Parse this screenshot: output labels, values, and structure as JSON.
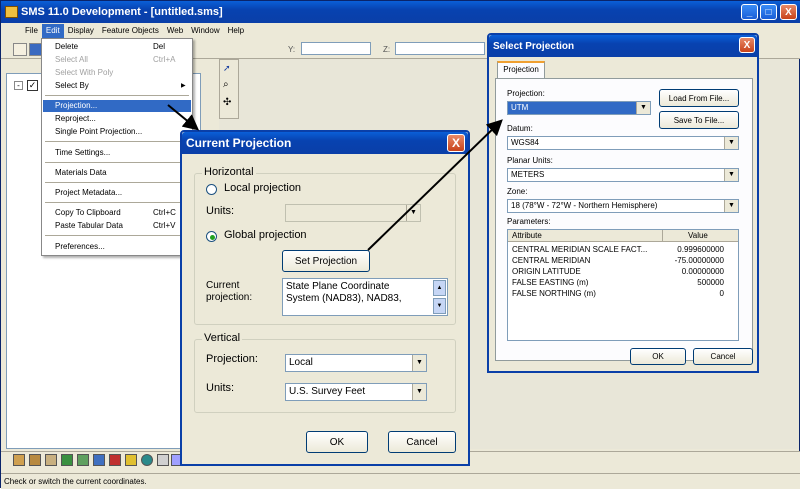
{
  "app": {
    "title": "SMS 11.0 Development - [untitled.sms]",
    "menu": [
      "File",
      "Edit",
      "Display",
      "Feature Objects",
      "Web",
      "Window",
      "Help"
    ],
    "coord_labels": [
      "Y:",
      "Z:"
    ],
    "status_text": "Check or switch the current coordinates.",
    "title_buttons": [
      "_",
      "□",
      "X"
    ]
  },
  "edit_menu": {
    "items": [
      {
        "label": "Delete",
        "shortcut": "Del"
      },
      {
        "label": "Select All",
        "shortcut": "Ctrl+A",
        "disabled": true
      },
      {
        "label": "Select With Poly",
        "disabled": true
      },
      {
        "label": "Select By",
        "submenu": "▶"
      },
      {
        "label": "Projection..."
      },
      {
        "label": "Reproject..."
      },
      {
        "label": "Single Point Projection..."
      },
      {
        "label": "Time Settings..."
      },
      {
        "label": "Materials Data"
      },
      {
        "label": "Project Metadata..."
      },
      {
        "label": "Copy To Clipboard",
        "shortcut": "Ctrl+C"
      },
      {
        "label": "Paste Tabular Data",
        "shortcut": "Ctrl+V"
      },
      {
        "label": "Preferences..."
      }
    ]
  },
  "current_projection": {
    "title": "Current Projection",
    "close": "X",
    "horizontal_label": "Horizontal",
    "local_projection": "Local projection",
    "units_label": "Units:",
    "global_projection": "Global projection",
    "set_projection": "Set Projection",
    "current_label_1": "Current",
    "current_label_2": "projection:",
    "current_value_1": "State Plane Coordinate",
    "current_value_2": "System (NAD83), NAD83,",
    "vertical_label": "Vertical",
    "v_projection_label": "Projection:",
    "v_projection_value": "Local",
    "v_units_label": "Units:",
    "v_units_value": "U.S. Survey Feet",
    "ok": "OK",
    "cancel": "Cancel"
  },
  "select_projection": {
    "title": "Select Projection",
    "close": "X",
    "tab": "Projection",
    "projection_label": "Projection:",
    "projection_value": "UTM",
    "load_btn": "Load From File...",
    "save_btn": "Save To File...",
    "datum_label": "Datum:",
    "datum_value": "WGS84",
    "planar_label": "Planar Units:",
    "planar_value": "METERS",
    "zone_label": "Zone:",
    "zone_value": "18 (78°W - 72°W - Northern Hemisphere)",
    "parameters_label": "Parameters:",
    "param_headers": [
      "Attribute",
      "Value"
    ],
    "params": [
      {
        "attr": "CENTRAL MERIDIAN SCALE FACT...",
        "value": "0.999600000"
      },
      {
        "attr": "CENTRAL MERIDIAN",
        "value": "-75.00000000"
      },
      {
        "attr": "ORIGIN LATITUDE",
        "value": "0.00000000"
      },
      {
        "attr": "FALSE EASTING (m)",
        "value": "500000"
      },
      {
        "attr": "FALSE NORTHING (m)",
        "value": "0"
      }
    ],
    "ok": "OK",
    "cancel": "Cancel"
  },
  "colors": {
    "title_bar": "#0a4fc8",
    "dialog_bg": "#ece9d8",
    "selection": "#316ac5"
  }
}
